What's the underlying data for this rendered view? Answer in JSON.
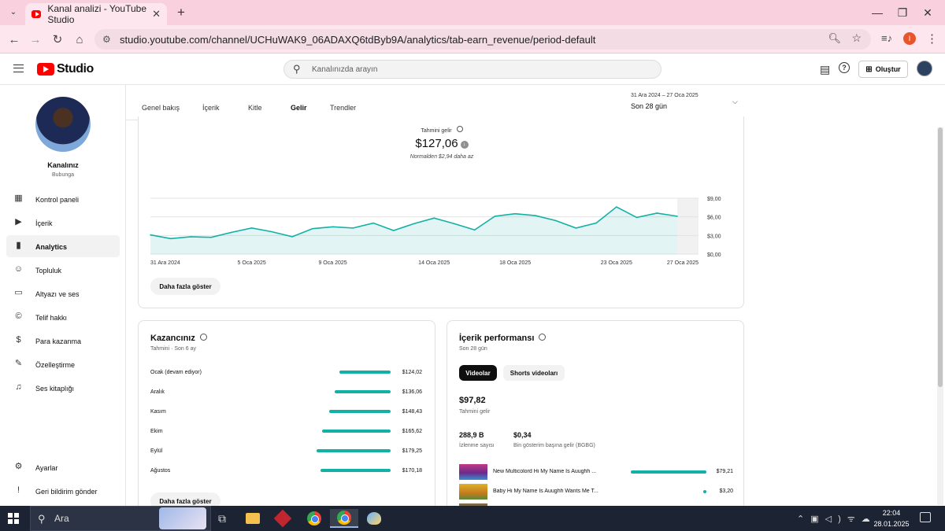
{
  "browser": {
    "tab_title": "Kanal analizi - YouTube Studio",
    "url": "studio.youtube.com/channel/UCHuWAK9_06ADAXQ6tdByb9A/analytics/tab-earn_revenue/period-default",
    "profile_initial": "I"
  },
  "header": {
    "logo_text": "Studio",
    "search_placeholder": "Kanalınızda arayın",
    "create_label": "Oluştur"
  },
  "sidebar": {
    "channel_name": "Kanalınız",
    "channel_handle": "Bubunga",
    "items": [
      {
        "label": "Kontrol paneli",
        "icon": "dashboard-icon"
      },
      {
        "label": "İçerik",
        "icon": "content-icon"
      },
      {
        "label": "Analytics",
        "icon": "analytics-icon",
        "active": true
      },
      {
        "label": "Topluluk",
        "icon": "community-icon"
      },
      {
        "label": "Altyazı ve ses",
        "icon": "subtitles-icon"
      },
      {
        "label": "Telif hakkı",
        "icon": "copyright-icon"
      },
      {
        "label": "Para kazanma",
        "icon": "monetization-icon"
      },
      {
        "label": "Özelleştirme",
        "icon": "customization-icon"
      },
      {
        "label": "Ses kitaplığı",
        "icon": "audio-library-icon"
      }
    ],
    "bottom_items": [
      {
        "label": "Ayarlar",
        "icon": "settings-icon"
      },
      {
        "label": "Geri bildirim gönder",
        "icon": "feedback-icon"
      }
    ]
  },
  "analytics": {
    "tabs": [
      "Genel bakış",
      "İçerik",
      "Kitle",
      "Gelir",
      "Trendler"
    ],
    "active_tab": "Gelir",
    "date_range": "31 Ara 2024 – 27 Oca 2025",
    "date_label": "Son 28 gün"
  },
  "revenue": {
    "label": "Tahmini gelir",
    "value": "$127,06",
    "comparison": "Normalden $2,94 daha az",
    "show_more": "Daha fazla göster"
  },
  "chart_data": {
    "type": "area",
    "title": "Tahmini gelir",
    "x_tick_labels": [
      "31 Ara 2024",
      "5 Oca 2025",
      "9 Oca 2025",
      "14 Oca 2025",
      "18 Oca 2025",
      "23 Oca 2025",
      "27 Oca 2025"
    ],
    "x_tick_index": [
      0,
      5,
      9,
      14,
      18,
      23,
      27
    ],
    "y_tick_labels": [
      "$9,00",
      "$6,00",
      "$3,00",
      "$0,00"
    ],
    "y_tick_values": [
      9,
      6,
      3,
      0
    ],
    "ylim": [
      0,
      9
    ],
    "grid": true,
    "series": [
      {
        "values": [
          3.1,
          2.5,
          2.8,
          2.7,
          3.5,
          4.2,
          3.6,
          2.8,
          4.1,
          4.4,
          4.2,
          5.0,
          3.8,
          4.9,
          5.8,
          4.9,
          3.9,
          6.1,
          6.5,
          6.2,
          5.4,
          4.2,
          5.0,
          7.6,
          5.9,
          6.6,
          6.1
        ]
      }
    ],
    "series_color": "#13b0a5"
  },
  "earnings": {
    "title": "Kazancınız",
    "subtitle": "Tahmini · Son 6 ay",
    "rows": [
      {
        "month": "Ocak (devam ediyor)",
        "value": "$124,02",
        "amount": 124.02
      },
      {
        "month": "Aralık",
        "value": "$136,06",
        "amount": 136.06
      },
      {
        "month": "Kasım",
        "value": "$148,43",
        "amount": 148.43
      },
      {
        "month": "Ekim",
        "value": "$165,62",
        "amount": 165.62
      },
      {
        "month": "Eylül",
        "value": "$179,25",
        "amount": 179.25
      },
      {
        "month": "Ağustos",
        "value": "$170,18",
        "amount": 170.18
      }
    ],
    "show_more": "Daha fazla göster"
  },
  "performance": {
    "title": "İçerik performansı",
    "subtitle": "Son 28 gün",
    "segments": [
      "Videolar",
      "Shorts videoları"
    ],
    "total_value": "$97,82",
    "total_label": "Tahmini gelir",
    "views_value": "288,9 B",
    "views_label": "İzlenme sayısı",
    "rpm_value": "$0,34",
    "rpm_label": "Bin gösterim başına gelir (BGBG)",
    "videos": [
      {
        "title": "New Multicolord Hi My Name Is Auughh ...",
        "value": "$79,21",
        "amount": 79.21
      },
      {
        "title": "Baby Hi My Name Is Auughh Wants Me T...",
        "value": "$3,20",
        "amount": 3.2
      }
    ]
  },
  "taskbar": {
    "search_label": "Ara",
    "time": "22:04",
    "date": "28.01.2025"
  }
}
